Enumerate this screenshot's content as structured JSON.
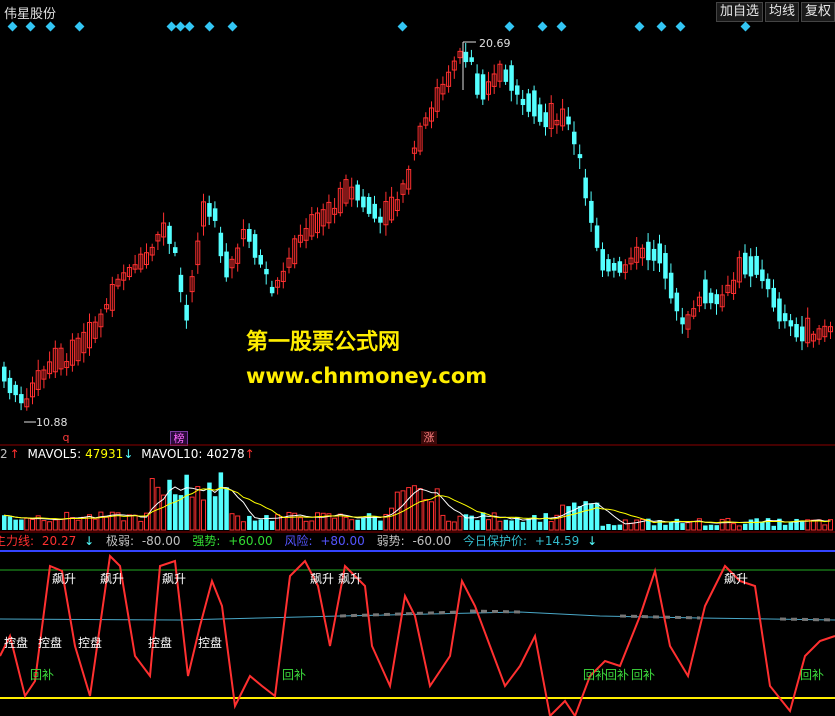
{
  "window": {
    "title": "伟星股份",
    "buttons": [
      "加自选",
      "均线",
      "复权"
    ]
  },
  "price_chart": {
    "high_label": "20.69",
    "low_label": "10.88",
    "flags": [
      {
        "text": "q",
        "color": "#ff3b3b"
      },
      {
        "text": "榜",
        "color": "#ff66ff"
      },
      {
        "text": "涨",
        "color": "#ff8080"
      }
    ]
  },
  "watermark": {
    "line1": "第一股票公式网",
    "line2": "www.chnmoney.com"
  },
  "volume": {
    "prefix": "2",
    "mavol5_label": "MAVOL5:",
    "mavol5_value": "47931",
    "mavol10_label": "MAVOL10:",
    "mavol10_value": "40278"
  },
  "indicator": {
    "items": [
      {
        "label": "主力线:",
        "value": "20.27",
        "arrow": "↓",
        "color": "#ff3030"
      },
      {
        "label": "极弱:",
        "value": "-80.00",
        "color": "#c0c0c0"
      },
      {
        "label": "强势:",
        "value": "+60.00",
        "color": "#33dd33"
      },
      {
        "label": "风险:",
        "value": "+80.00",
        "color": "#5555ff"
      },
      {
        "label": "弱势:",
        "value": "-60.00",
        "color": "#c0c0c0"
      },
      {
        "label": "今日保护价:",
        "value": "+14.59",
        "arrow": "↓",
        "color": "#33bbcc"
      }
    ],
    "signals": {
      "rise": "飙升",
      "control": "控盘",
      "rebound": "回补"
    }
  },
  "colors": {
    "up": "#ff3030",
    "down": "#54ffff",
    "diamond": "#33c6f4",
    "mavol5": "#ffffff",
    "mavol10": "#ffff00"
  }
}
